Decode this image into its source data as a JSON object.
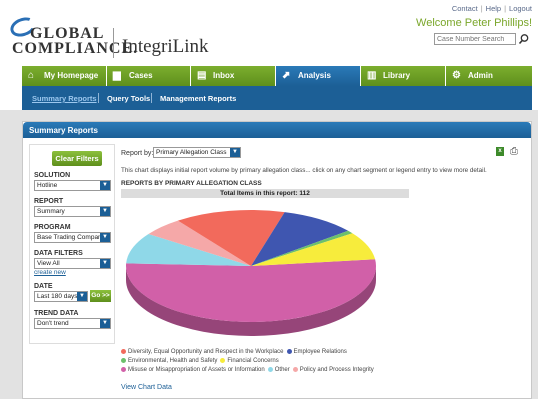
{
  "header": {
    "logo_top": "GLOBAL",
    "logo_bottom": "COMPLIANCE.",
    "product": "IntegriLink",
    "links": [
      "Contact",
      "Help",
      "Logout"
    ],
    "welcome": "Welcome Peter Phillips!",
    "case_search_placeholder": "Case Number Search"
  },
  "nav": {
    "tabs": [
      {
        "label": "My Homepage",
        "icon": "home-icon",
        "active": false
      },
      {
        "label": "Cases",
        "icon": "briefcase-icon",
        "active": false
      },
      {
        "label": "Inbox",
        "icon": "inbox-icon",
        "active": false
      },
      {
        "label": "Analysis",
        "icon": "chart-icon",
        "active": true
      },
      {
        "label": "Library",
        "icon": "books-icon",
        "active": false
      },
      {
        "label": "Admin",
        "icon": "gears-icon",
        "active": false
      }
    ]
  },
  "subnav": {
    "items": [
      "Summary Reports",
      "Query Tools",
      "Management Reports"
    ],
    "active_index": 0
  },
  "panel": {
    "title": "Summary Reports"
  },
  "sidebar": {
    "clear_filters": "Clear Filters",
    "solution_label": "SOLUTION",
    "solution_value": "Hotline",
    "report_label": "REPORT",
    "report_value": "Summary",
    "program_label": "PROGRAM",
    "program_value": "Base Trading Company",
    "filters_label": "DATA FILTERS",
    "filters_value": "View All",
    "create_new": "create new",
    "date_label": "DATE",
    "date_value": "Last 180 days",
    "go": "Go >>",
    "trend_label": "TREND DATA",
    "trend_value": "Don't trend"
  },
  "main": {
    "report_by_label": "Report by:",
    "report_by_value": "Primary Allegation Class",
    "description": "This chart displays initial report volume by primary allegation class... click on any chart segment or legend entry to view more detail.",
    "chart_heading": "REPORTS BY PRIMARY ALLEGATION CLASS",
    "total_label": "Total Items in this report:",
    "total_value": "112",
    "view_chart_data": "View Chart Data"
  },
  "chart_data": {
    "type": "pie",
    "title": "REPORTS BY PRIMARY ALLEGATION CLASS",
    "total": 112,
    "slices": [
      {
        "label": "Misuse or Misappropriation of Assets or Information",
        "value": 59,
        "color": "#d160a8"
      },
      {
        "label": "Other",
        "value": 10,
        "color": "#8fd8e8"
      },
      {
        "label": "Policy and Process Integrity",
        "value": 6,
        "color": "#f5a8a8"
      },
      {
        "label": "Diversity, Equal Opportunity and Respect in the Workplace",
        "value": 16,
        "color": "#f26a5c"
      },
      {
        "label": "Employee Relations",
        "value": 11,
        "color": "#3f56b0"
      },
      {
        "label": "Environmental, Health and Safety",
        "value": 1,
        "color": "#6cc06c"
      },
      {
        "label": "Financial Concerns",
        "value": 9,
        "color": "#f7ec3c"
      }
    ],
    "legend": [
      {
        "label": "Diversity, Equal Opportunity and Respect in the Workplace",
        "color": "#f26a5c"
      },
      {
        "label": "Employee Relations",
        "color": "#3f56b0"
      },
      {
        "label": "Environmental, Health and Safety",
        "color": "#6cc06c"
      },
      {
        "label": "Financial Concerns",
        "color": "#f7ec3c"
      },
      {
        "label": "Misuse or Misappropriation of Assets or Information",
        "color": "#d160a8"
      },
      {
        "label": "Other",
        "color": "#8fd8e8"
      },
      {
        "label": "Policy and Process Integrity",
        "color": "#f5a8a8"
      }
    ],
    "legend_position": "bottom"
  }
}
